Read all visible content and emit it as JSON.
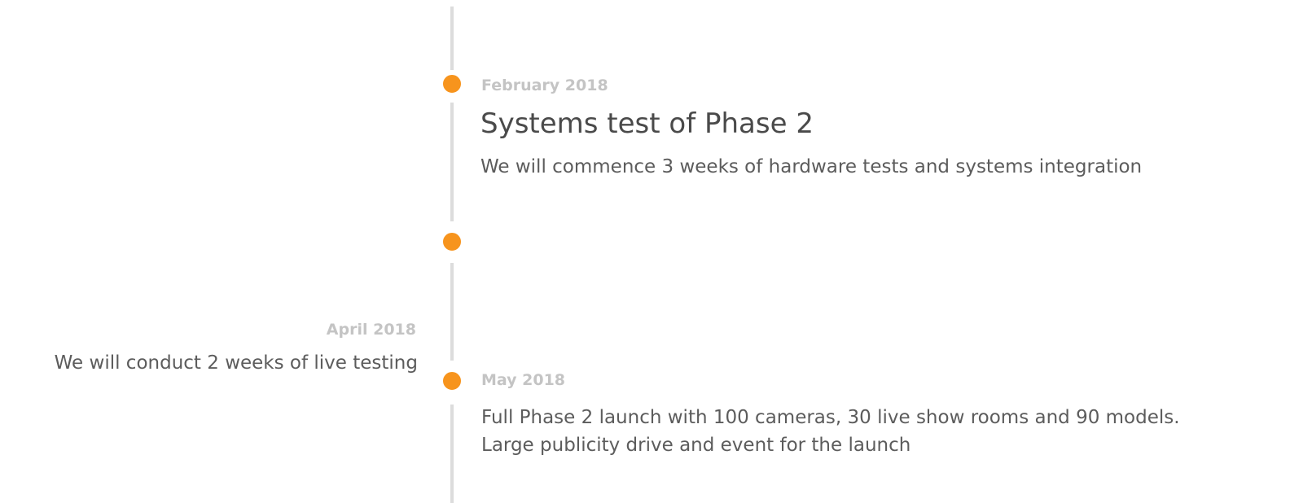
{
  "accent_color": "#f7941d",
  "line_color": "#dcdcdc",
  "events": [
    {
      "date": "February 2018",
      "title": "Systems test of Phase 2",
      "description": "We will commence 3 weeks of hardware tests and systems integration"
    },
    {
      "date": "",
      "title": "",
      "description": ""
    },
    {
      "date": "April 2018",
      "description": "We will conduct 2 weeks of live testing"
    },
    {
      "date": "May 2018",
      "description_lines": [
        "Full Phase 2 launch with 100 cameras, 30 live show rooms and 90 models.",
        "Large publicity drive and event for the launch"
      ]
    }
  ]
}
